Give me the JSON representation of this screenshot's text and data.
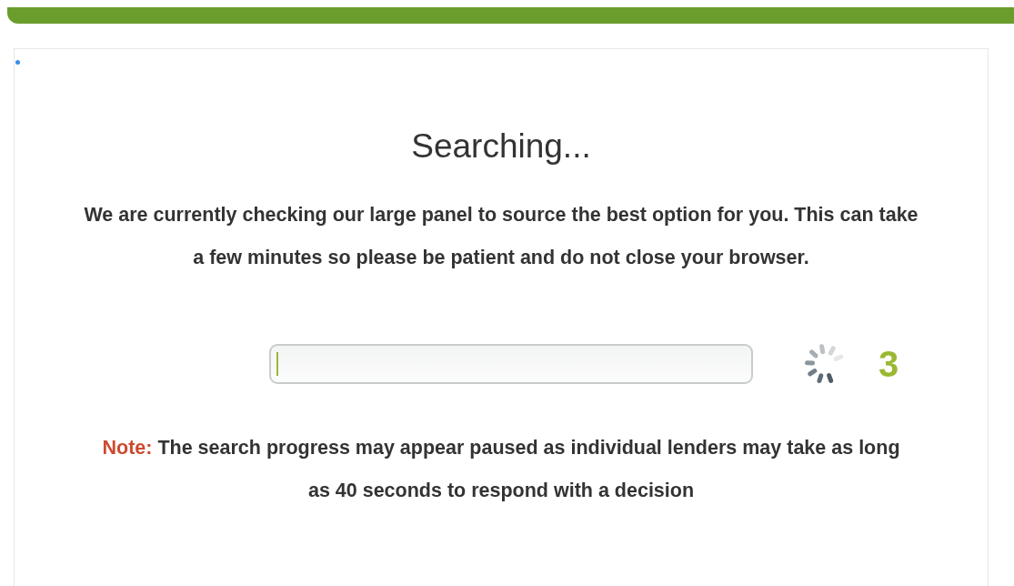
{
  "title": "Searching...",
  "message": "We are currently checking our large panel to source the best option for you. This can take a few minutes so please be patient and do not close your browser.",
  "progress": {
    "level": 0.01,
    "count": "3"
  },
  "note": {
    "label": "Note:",
    "text": "The search progress may appear paused as individual lenders may take as long as 40 seconds to respond with a decision"
  }
}
